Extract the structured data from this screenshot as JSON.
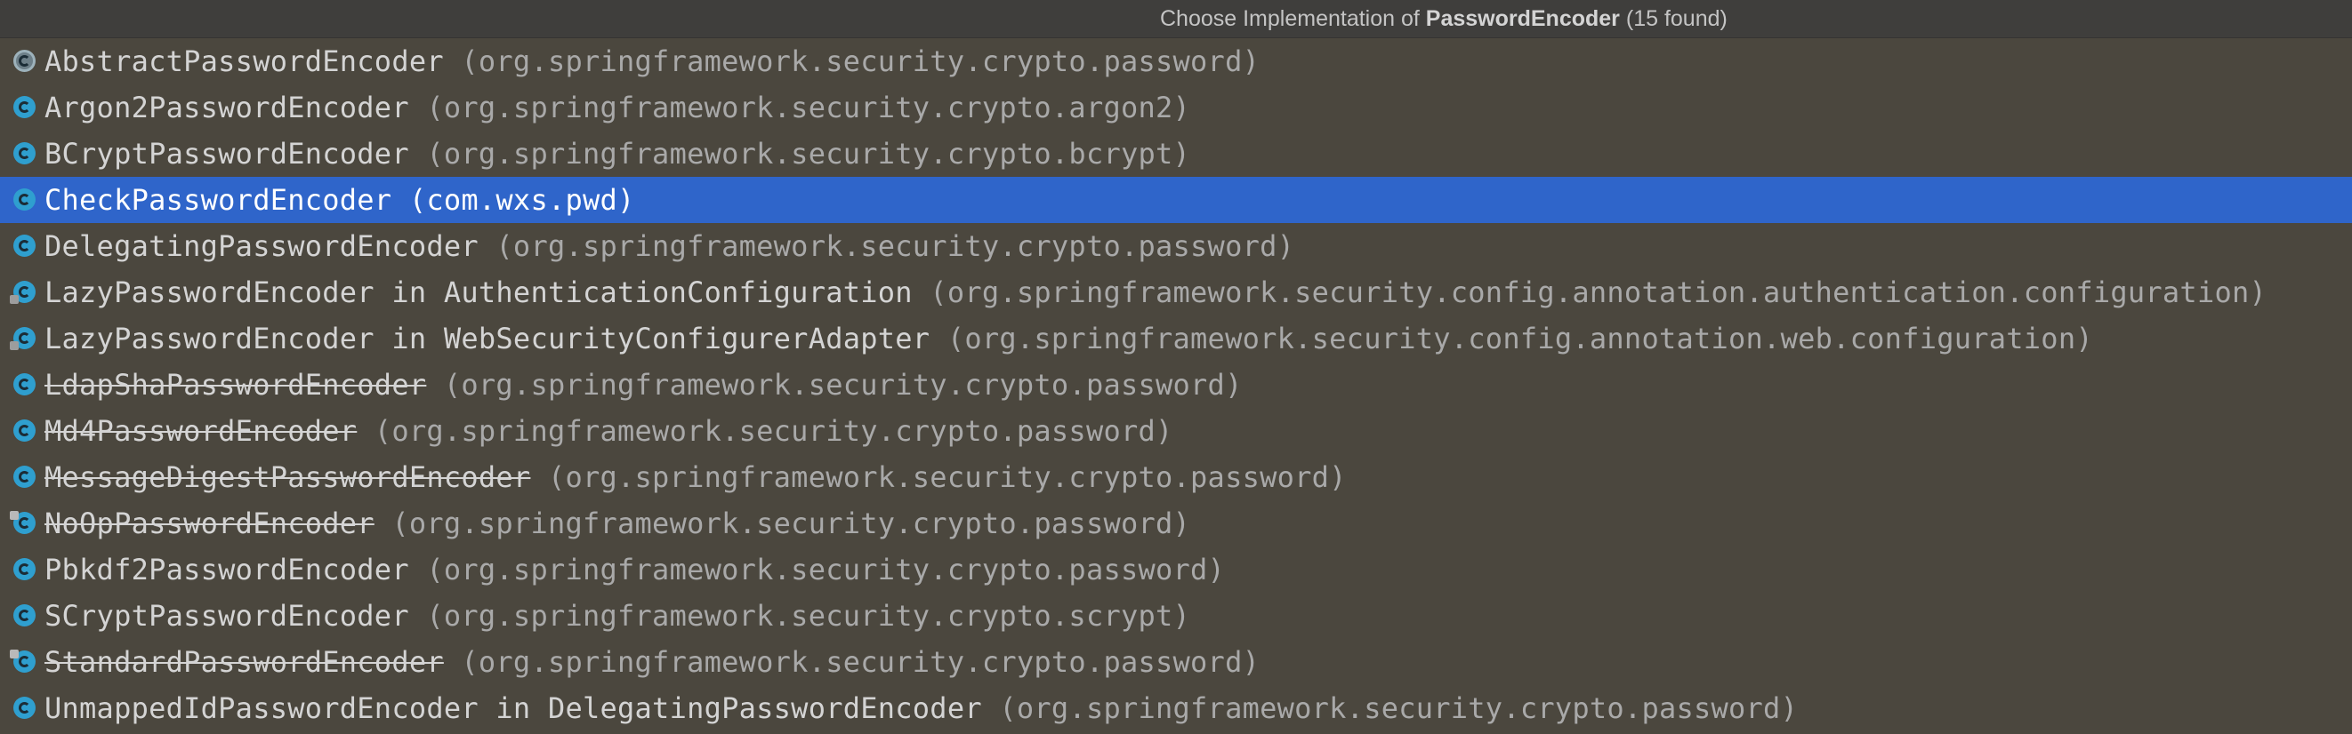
{
  "header": {
    "prefix": "Choose Implementation of ",
    "interface_name": "PasswordEncoder",
    "count": " (15 found)"
  },
  "items": [
    {
      "name": "AbstractPasswordEncoder",
      "pkg": "(org.springframework.security.crypto.password)",
      "deprecated": false,
      "icon": "abstract-class-icon",
      "selected": false
    },
    {
      "name": "Argon2PasswordEncoder",
      "pkg": "(org.springframework.security.crypto.argon2)",
      "deprecated": false,
      "icon": "class-icon",
      "selected": false
    },
    {
      "name": "BCryptPasswordEncoder",
      "pkg": "(org.springframework.security.crypto.bcrypt)",
      "deprecated": false,
      "icon": "class-icon",
      "selected": false
    },
    {
      "name": "CheckPasswordEncoder",
      "pkg": "(com.wxs.pwd)",
      "deprecated": false,
      "icon": "class-icon",
      "selected": true
    },
    {
      "name": "DelegatingPasswordEncoder",
      "pkg": "(org.springframework.security.crypto.password)",
      "deprecated": false,
      "icon": "class-icon",
      "selected": false
    },
    {
      "name": "LazyPasswordEncoder in AuthenticationConfiguration",
      "pkg": "(org.springframework.security.config.annotation.authentication.configuration)",
      "deprecated": false,
      "icon": "inner-class-icon",
      "selected": false
    },
    {
      "name": "LazyPasswordEncoder in WebSecurityConfigurerAdapter",
      "pkg": "(org.springframework.security.config.annotation.web.configuration)",
      "deprecated": false,
      "icon": "inner-class-icon",
      "selected": false
    },
    {
      "name": "LdapShaPasswordEncoder",
      "pkg": "(org.springframework.security.crypto.password)",
      "deprecated": true,
      "icon": "class-icon",
      "selected": false
    },
    {
      "name": "Md4PasswordEncoder",
      "pkg": "(org.springframework.security.crypto.password)",
      "deprecated": true,
      "icon": "class-icon",
      "selected": false
    },
    {
      "name": "MessageDigestPasswordEncoder",
      "pkg": "(org.springframework.security.crypto.password)",
      "deprecated": true,
      "icon": "class-icon",
      "selected": false
    },
    {
      "name": "NoOpPasswordEncoder",
      "pkg": "(org.springframework.security.crypto.password)",
      "deprecated": true,
      "icon": "final-class-icon",
      "selected": false
    },
    {
      "name": "Pbkdf2PasswordEncoder",
      "pkg": "(org.springframework.security.crypto.password)",
      "deprecated": false,
      "icon": "class-icon",
      "selected": false
    },
    {
      "name": "SCryptPasswordEncoder",
      "pkg": "(org.springframework.security.crypto.scrypt)",
      "deprecated": false,
      "icon": "class-icon",
      "selected": false
    },
    {
      "name": "StandardPasswordEncoder",
      "pkg": "(org.springframework.security.crypto.password)",
      "deprecated": true,
      "icon": "final-class-icon",
      "selected": false
    },
    {
      "name": "UnmappedIdPasswordEncoder in DelegatingPasswordEncoder",
      "pkg": "(org.springframework.security.crypto.password)",
      "deprecated": false,
      "icon": "class-icon",
      "selected": false
    }
  ],
  "colors": {
    "background": "#4b473e",
    "header_background": "#3f3e3c",
    "selection": "#2f65ca",
    "class_icon": "#2f9fcf"
  }
}
